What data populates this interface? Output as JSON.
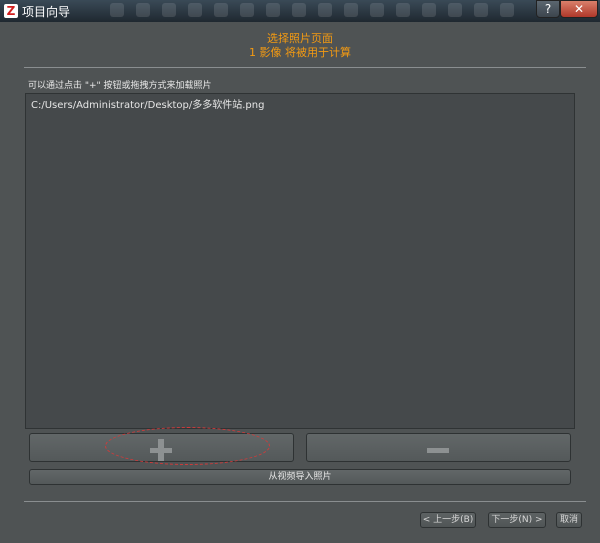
{
  "window": {
    "title": "项目向导",
    "app_icon_letter": "Z",
    "help_label": "?",
    "close_label": "✕"
  },
  "header": {
    "title": "选择照片页面",
    "subtitle": "1 影像 将被用于计算"
  },
  "instruction": "可以通过点击 \"+\" 按钮或拖拽方式来加载照片",
  "photo_list": {
    "items": [
      "C:/Users/Administrator/Desktop/多多软件站.png"
    ]
  },
  "buttons": {
    "import_video_label": "从视频导入照片",
    "prev_label": "< 上一步(B)",
    "next_label": "下一步(N) >",
    "cancel_label": "取消"
  },
  "colors": {
    "accent": "#f39a12",
    "background": "#4f5354",
    "highlight_ellipse": "#d23a3a"
  }
}
